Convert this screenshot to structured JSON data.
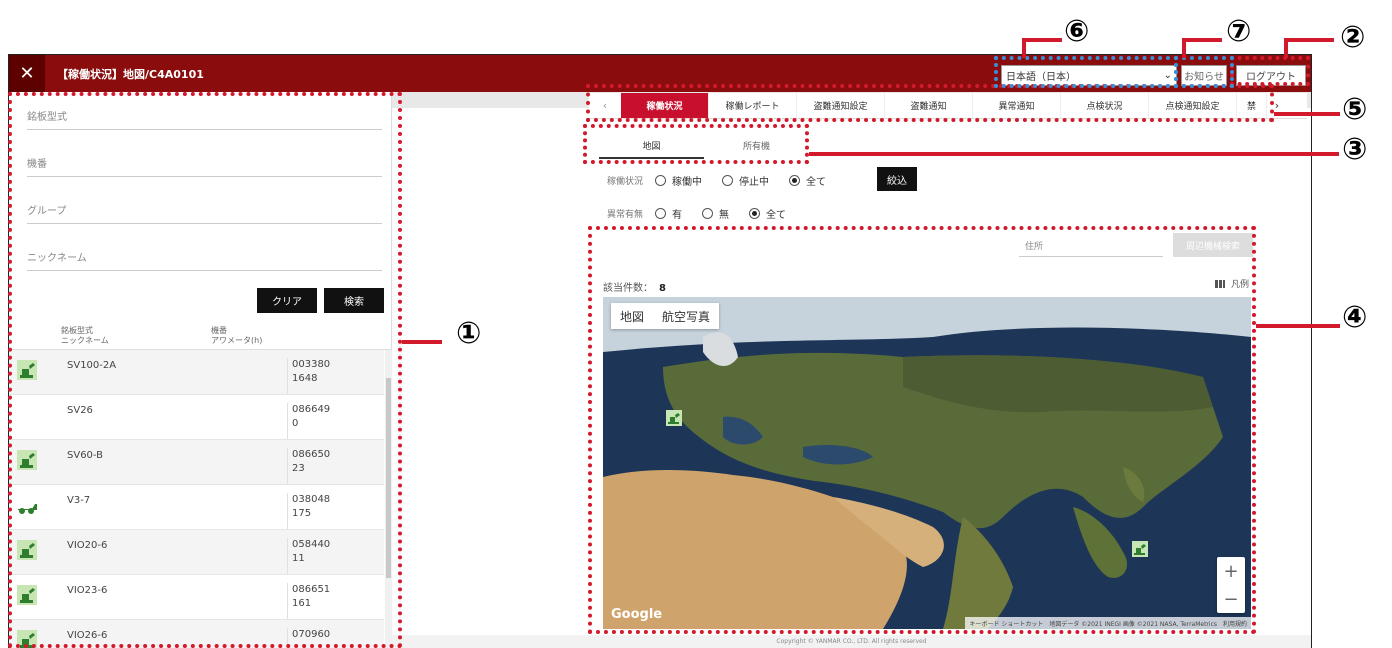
{
  "window": {
    "close_glyph": "✕",
    "title": "【稼働状況】地図/C4A0101",
    "language_value": "日本語（日本）",
    "notice_label": "お知らせ",
    "logout_label": "ログアウト"
  },
  "search": {
    "fields": [
      "銘板型式",
      "機番",
      "グループ",
      "ニックネーム"
    ],
    "clear_label": "クリア",
    "search_label": "検索"
  },
  "list": {
    "header": {
      "col1_line1": "銘板型式",
      "col1_line2": "ニックネーム",
      "col2_line1": "機番",
      "col2_line2": "アワメータ(h)"
    },
    "rows": [
      {
        "model": "SV100-2A",
        "serial": "003380",
        "hours": "1648",
        "icon": "excavator-icon"
      },
      {
        "model": "SV26",
        "serial": "086649",
        "hours": "0",
        "icon": ""
      },
      {
        "model": "SV60-B",
        "serial": "086650",
        "hours": "23",
        "icon": "excavator-icon"
      },
      {
        "model": "V3-7",
        "serial": "038048",
        "hours": "175",
        "icon": "wheel-loader-icon"
      },
      {
        "model": "VIO20-6",
        "serial": "058440",
        "hours": "11",
        "icon": "excavator-icon"
      },
      {
        "model": "VIO23-6",
        "serial": "086651",
        "hours": "161",
        "icon": "excavator-icon"
      },
      {
        "model": "VIO26-6",
        "serial": "070960",
        "hours": "",
        "icon": "excavator-icon"
      }
    ]
  },
  "tabs": {
    "prev": "‹",
    "next": "›",
    "items": [
      "稼働状況",
      "稼働レポート",
      "盗難通知設定",
      "盗難通知",
      "異常通知",
      "点検状況",
      "点検通知設定",
      "禁"
    ]
  },
  "subtabs": [
    "地図",
    "所有機"
  ],
  "filters": {
    "status_label": "稼働状況",
    "status_options": [
      "稼働中",
      "停止中",
      "全て"
    ],
    "status_selected": 2,
    "filter_button": "絞込",
    "abnormal_label": "異常有無",
    "abnormal_options": [
      "有",
      "無",
      "全て"
    ],
    "abnormal_selected": 2
  },
  "map": {
    "address_placeholder": "住所",
    "nearby_button": "周辺機械検索",
    "count_label": "該当件数：",
    "count_value": "8",
    "legend_label": "凡例",
    "maptype": [
      "地図",
      "航空写真"
    ],
    "zoom_in": "+",
    "zoom_out": "−",
    "google_logo": "Google",
    "attribution": "キーボード ショートカット　地図データ ©2021 INEGI 画像 ©2021 NASA, TerraMetrics　利用規約"
  },
  "footer": {
    "copyright": "Copyright © YANMAR CO., LTD. All rights reserved"
  },
  "callouts": [
    "①",
    "②",
    "③",
    "④",
    "⑤",
    "⑥",
    "⑦"
  ],
  "colors": {
    "titlebar": "#8a0c0c",
    "active_tab": "#c8102e",
    "annotation_red": "#d31a2c",
    "annotation_blue": "#3b8fd4"
  }
}
